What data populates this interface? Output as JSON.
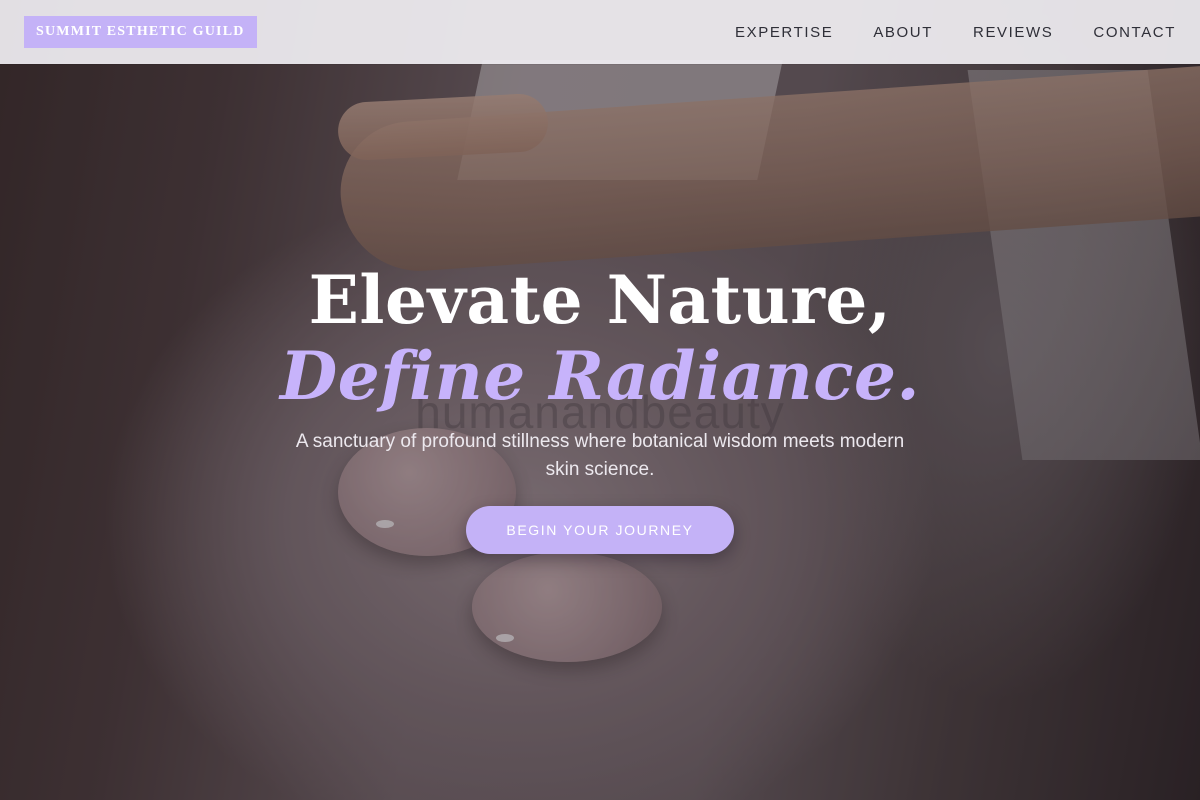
{
  "header": {
    "logo_text": "SUMMIT ESTHETIC GUILD",
    "nav": [
      {
        "label": "EXPERTISE"
      },
      {
        "label": "ABOUT"
      },
      {
        "label": "REVIEWS"
      },
      {
        "label": "CONTACT"
      }
    ]
  },
  "hero": {
    "headline_line1": "Elevate Nature,",
    "headline_line2": "Define Radiance.",
    "watermark": "humanandbeauty",
    "subtitle": "A sanctuary of profound stillness where botanical wisdom meets modern skin science.",
    "cta_label": "BEGIN YOUR JOURNEY",
    "background_image": "massage with hand and stones on skin"
  },
  "colors": {
    "accent": "#c4b2f7",
    "accent_text": "#c7b3fb",
    "header_bg": "#f0eef2",
    "nav_text": "#2f2f38"
  }
}
